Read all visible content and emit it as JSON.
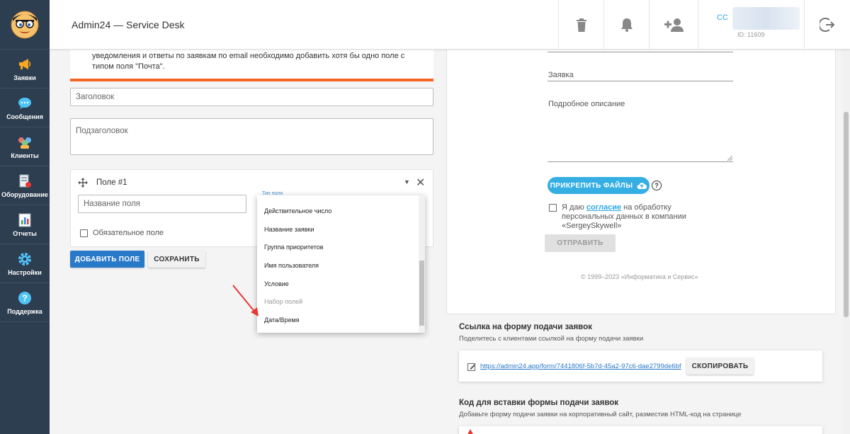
{
  "app": {
    "title": "Admin24 — Service Desk"
  },
  "sidebar": {
    "items": [
      {
        "label": "Заявки",
        "icon": "megaphone-icon"
      },
      {
        "label": "Сообщения",
        "icon": "chat-icon"
      },
      {
        "label": "Клиенты",
        "icon": "clients-icon"
      },
      {
        "label": "Оборудование",
        "icon": "equipment-icon"
      },
      {
        "label": "Отчеты",
        "icon": "report-icon"
      },
      {
        "label": "Настройки",
        "icon": "gear-icon"
      },
      {
        "label": "Поддержка",
        "icon": "help-icon"
      }
    ]
  },
  "header": {
    "user_initials": "CC",
    "user_id": "ID: 11609"
  },
  "left": {
    "warning_text": "уведомления и ответы по заявкам по email необходимо добавить хотя бы одно поле с типом поля \"Почта\".",
    "title_placeholder": "Заголовок",
    "subtitle_placeholder": "Подзаголовок",
    "field": {
      "name": "Поле #1",
      "name_placeholder": "Название поля",
      "type_label": "Тип поля",
      "required_label": "Обязательное поле"
    },
    "add_field_label": "ДОБАВИТЬ ПОЛЕ",
    "save_label": "СОХРАНИТЬ"
  },
  "dropdown": {
    "options": [
      {
        "label": "Действительное число",
        "disabled": false
      },
      {
        "label": "Название заявки",
        "disabled": false
      },
      {
        "label": "Группа приоритетов",
        "disabled": false
      },
      {
        "label": "Имя пользователя",
        "disabled": false
      },
      {
        "label": "Условие",
        "disabled": false
      },
      {
        "label": "Набор полей",
        "disabled": true
      },
      {
        "label": "Дата/Время",
        "disabled": false
      }
    ]
  },
  "preview": {
    "request_label": "Заявка",
    "description_label": "Подробное описание",
    "attach_label": "ПРИКРЕПИТЬ ФАЙЛЫ",
    "consent_prefix": "Я даю",
    "consent_link": "согласие",
    "consent_suffix": "на обработку персональных данных в компании «SergeySkywell»",
    "send_label": "ОТПРАВИТЬ",
    "copyright": "© 1999–2023 «Информатика и Сервис»"
  },
  "link_section": {
    "title": "Ссылка на форму подачи заявок",
    "subtitle": "Поделитесь с клиентами ссылкой на форму подачи заявки",
    "url": "https://admin24.app/form/7441806f-5b7d-45a2-97c6-dae2799de6bf",
    "copy_label": "СКОПИРОВАТЬ"
  },
  "embed_section": {
    "title": "Код для вставки формы подачи заявок",
    "subtitle": "Добавьте форму подачи заявки на корпоративный сайт, разместив HTML-код на странице"
  },
  "colors": {
    "sidebar": "#2d3e50",
    "primary": "#2979c9",
    "accent": "#34aee3",
    "warning": "#f26522",
    "arrow": "#e53935"
  }
}
